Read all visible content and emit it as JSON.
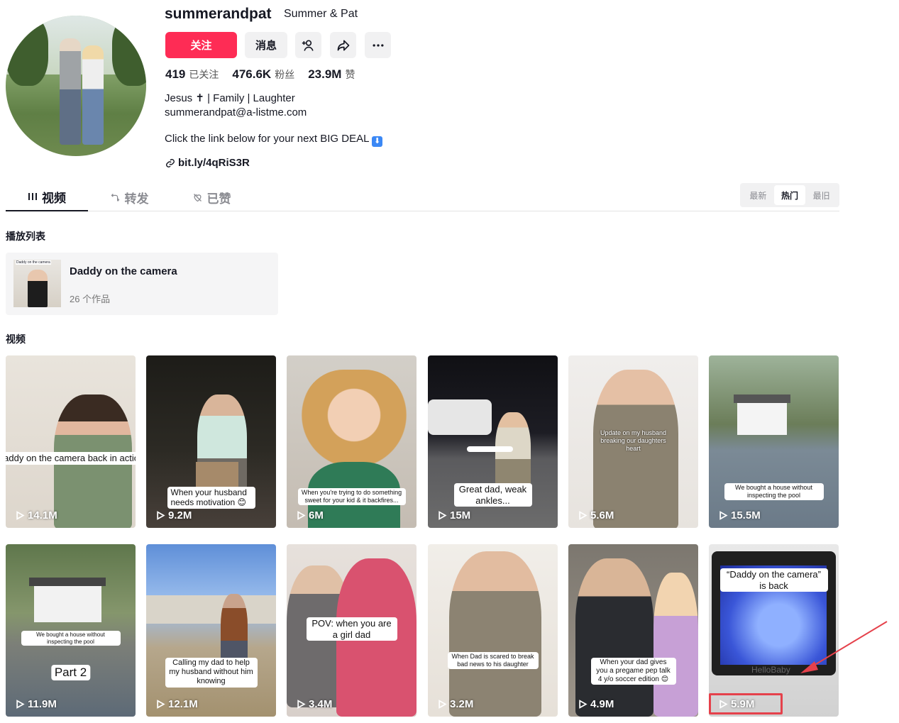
{
  "profile": {
    "username": "summerandpat",
    "nickname": "Summer & Pat",
    "follow_label": "关注",
    "message_label": "消息",
    "stats": [
      {
        "value": "419",
        "label": "已关注"
      },
      {
        "value": "476.6K",
        "label": "粉丝"
      },
      {
        "value": "23.9M",
        "label": "赞"
      }
    ],
    "bio_line1": "Jesus ✝ | Family | Laughter",
    "bio_line2": "summerandpat@a-listme.com",
    "bio_line3": "Click the link below for your next BIG DEAL",
    "link": "bit.ly/4qRiS3R"
  },
  "tabs": [
    {
      "label": "视频",
      "active": true
    },
    {
      "label": "转发",
      "active": false
    },
    {
      "label": "已赞",
      "active": false
    }
  ],
  "sort_options": [
    "最新",
    "热门",
    "最旧"
  ],
  "sort_selected": "热门",
  "playlist_section_title": "播放列表",
  "playlist": {
    "title": "Daddy on the camera",
    "count": "26 个作品",
    "thumb_caption": "Daddy on the camera"
  },
  "videos_section_title": "视频",
  "videos": [
    {
      "caption": "Daddy on the camera back in action",
      "views": "14.1M"
    },
    {
      "caption": "When your husband needs motivation 😊",
      "views": "9.2M"
    },
    {
      "caption": "When you're trying to do something sweet for your kid & it backfires...",
      "views": "6M"
    },
    {
      "caption": "Great dad, weak ankles...",
      "views": "15M"
    },
    {
      "caption": "Update on my husband breaking our daughters heart",
      "views": "5.6M"
    },
    {
      "caption": "We bought a house without inspecting the pool",
      "views": "15.5M"
    },
    {
      "caption": "We bought a house without inspecting the pool",
      "caption2": "Part 2",
      "views": "11.9M"
    },
    {
      "caption": "Calling my dad to help my husband without him knowing",
      "views": "12.1M"
    },
    {
      "caption": "POV: when you are a girl dad",
      "views": "3.4M"
    },
    {
      "caption": "When Dad is scared to break bad news to his daughter",
      "views": "3.2M"
    },
    {
      "caption": "When your dad gives you a pregame pep talk 4 y/o soccer edition 😊",
      "views": "4.9M"
    },
    {
      "caption": "“Daddy on the camera” is back",
      "monitor_brand": "HelloBaby",
      "views": "5.9M"
    }
  ],
  "colors": {
    "accent": "#fe2c55",
    "highlight_box": "#e5414b"
  }
}
